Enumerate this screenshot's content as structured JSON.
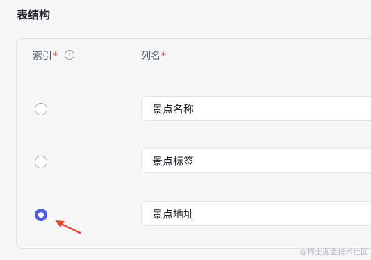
{
  "section": {
    "title": "表结构"
  },
  "table": {
    "headers": {
      "index_label": "索引",
      "index_required": "*",
      "info_icon": "info-circle-icon",
      "info_glyph": "i",
      "column_label": "列名",
      "column_required": "*"
    },
    "rows": [
      {
        "column_name": "景点名称",
        "index_selected": false
      },
      {
        "column_name": "景点标签",
        "index_selected": false
      },
      {
        "column_name": "景点地址",
        "index_selected": true
      }
    ]
  },
  "annotation": {
    "arrow_color": "#e8452f",
    "pointer_icon": "red-arrow-icon"
  },
  "colors": {
    "accent": "#4e5ee4",
    "required": "#f53f3f"
  },
  "watermark": "@稀土掘金技术社区"
}
